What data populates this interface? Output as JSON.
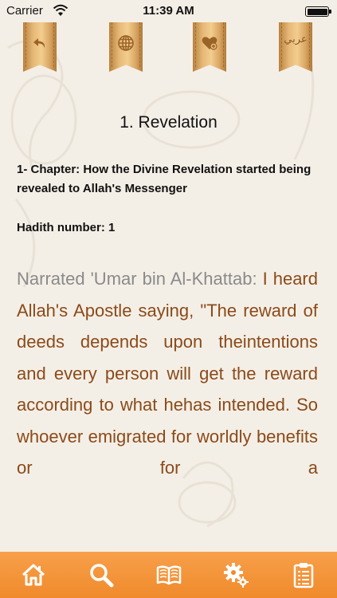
{
  "status_bar": {
    "carrier": "Carrier",
    "time": "11:39 AM"
  },
  "toolbar": {
    "arabic_label": "عربي",
    "accent_color": "#e6b877"
  },
  "content": {
    "title": "1. Revelation",
    "chapter": "1- Chapter: How the Divine Revelation started being revealed to Allah's Messenger",
    "hadith_number": "Hadith number: 1",
    "narrator": "Narrated 'Umar bin Al-Khattab:",
    "text": " I heard Allah's Apostle saying, \"The reward of deeds depends upon theintentions and every person will get the reward according to what hehas intended. So whoever emigrated for worldly benefits or for a",
    "text_color": "#8b4a1a",
    "narrator_color": "#8a8a8a"
  },
  "tab_bar": {
    "background": "#f08a2c",
    "tabs": [
      "home-icon",
      "search-icon",
      "book-icon",
      "settings-icon",
      "clipboard-icon"
    ]
  }
}
